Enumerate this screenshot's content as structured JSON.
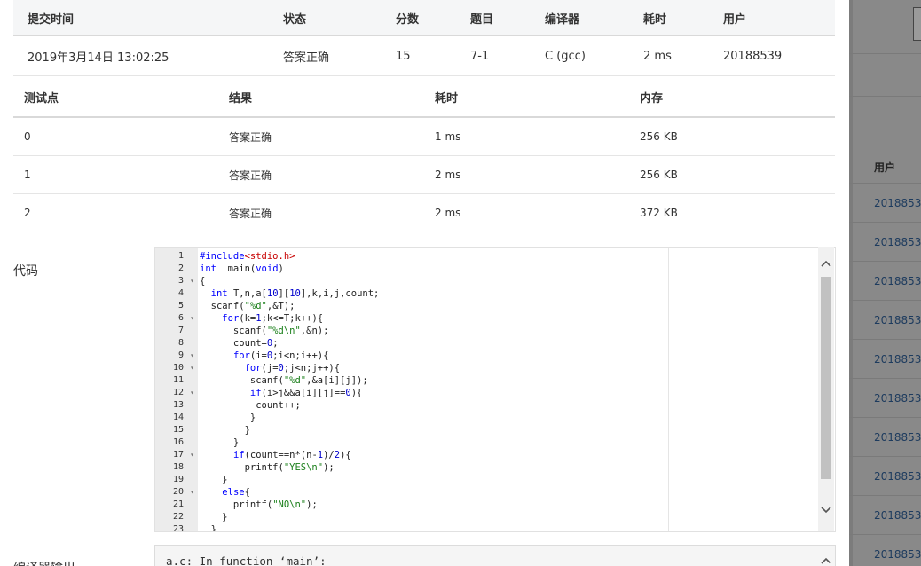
{
  "submission": {
    "headers": [
      "提交时间",
      "状态",
      "分数",
      "题目",
      "编译器",
      "耗时",
      "用户"
    ],
    "row": {
      "time": "2019年3月14日 13:02:25",
      "status": "答案正确",
      "score": "15",
      "problem": "7-1",
      "compiler": "C (gcc)",
      "duration": "2 ms",
      "user": "20188539"
    }
  },
  "testcases": {
    "headers": [
      "测试点",
      "结果",
      "耗时",
      "内存"
    ],
    "rows": [
      {
        "id": "0",
        "result": "答案正确",
        "time": "1 ms",
        "memory": "256 KB"
      },
      {
        "id": "1",
        "result": "答案正确",
        "time": "2 ms",
        "memory": "256 KB"
      },
      {
        "id": "2",
        "result": "答案正确",
        "time": "2 ms",
        "memory": "372 KB"
      }
    ]
  },
  "code_label": "代码",
  "compile_label": "编译器输出",
  "compile_output": "a.c: In function ‘main’:",
  "code": {
    "lines": [
      {
        "n": "1",
        "fold": "",
        "tokens": [
          [
            "inc",
            "#include"
          ],
          [
            "incpath",
            "<stdio.h>"
          ]
        ]
      },
      {
        "n": "2",
        "fold": "",
        "tokens": [
          [
            "kw",
            "int"
          ],
          [
            "",
            "  main("
          ],
          [
            "kw",
            "void"
          ],
          [
            "",
            ")"
          ]
        ]
      },
      {
        "n": "3",
        "fold": "▾",
        "tokens": [
          [
            "",
            "{"
          ]
        ]
      },
      {
        "n": "4",
        "fold": "",
        "tokens": [
          [
            "",
            "  "
          ],
          [
            "kw",
            "int"
          ],
          [
            "",
            " T,n,a["
          ],
          [
            "num",
            "10"
          ],
          [
            "",
            "]["
          ],
          [
            "num",
            "10"
          ],
          [
            "",
            "],k,i,j,count;"
          ]
        ]
      },
      {
        "n": "5",
        "fold": "",
        "tokens": [
          [
            "",
            "  scanf("
          ],
          [
            "str",
            "\"%d\""
          ],
          [
            "",
            ",&T);"
          ]
        ]
      },
      {
        "n": "6",
        "fold": "▾",
        "tokens": [
          [
            "",
            "    "
          ],
          [
            "kw",
            "for"
          ],
          [
            "",
            "(k="
          ],
          [
            "num",
            "1"
          ],
          [
            "",
            ";k<=T;k++){"
          ]
        ]
      },
      {
        "n": "7",
        "fold": "",
        "tokens": [
          [
            "",
            "      scanf("
          ],
          [
            "str",
            "\"%d\\n\""
          ],
          [
            "",
            ",&n);"
          ]
        ]
      },
      {
        "n": "8",
        "fold": "",
        "tokens": [
          [
            "",
            "      count="
          ],
          [
            "num",
            "0"
          ],
          [
            "",
            ";"
          ]
        ]
      },
      {
        "n": "9",
        "fold": "▾",
        "tokens": [
          [
            "",
            "      "
          ],
          [
            "kw",
            "for"
          ],
          [
            "",
            "(i="
          ],
          [
            "num",
            "0"
          ],
          [
            "",
            ";i<n;i++){"
          ]
        ]
      },
      {
        "n": "10",
        "fold": "▾",
        "tokens": [
          [
            "",
            "        "
          ],
          [
            "kw",
            "for"
          ],
          [
            "",
            "(j="
          ],
          [
            "num",
            "0"
          ],
          [
            "",
            ";j<n;j++){"
          ]
        ]
      },
      {
        "n": "11",
        "fold": "",
        "tokens": [
          [
            "",
            "         scanf("
          ],
          [
            "str",
            "\"%d\""
          ],
          [
            "",
            ",&a[i][j]);"
          ]
        ]
      },
      {
        "n": "12",
        "fold": "▾",
        "tokens": [
          [
            "",
            "         "
          ],
          [
            "kw",
            "if"
          ],
          [
            "",
            "(i>j&&a[i][j]=="
          ],
          [
            "num",
            "0"
          ],
          [
            "",
            "){"
          ]
        ]
      },
      {
        "n": "13",
        "fold": "",
        "tokens": [
          [
            "",
            "          count++;"
          ]
        ]
      },
      {
        "n": "14",
        "fold": "",
        "tokens": [
          [
            "",
            "         }"
          ]
        ]
      },
      {
        "n": "15",
        "fold": "",
        "tokens": [
          [
            "",
            "        }"
          ]
        ]
      },
      {
        "n": "16",
        "fold": "",
        "tokens": [
          [
            "",
            "      }"
          ]
        ]
      },
      {
        "n": "17",
        "fold": "▾",
        "tokens": [
          [
            "",
            "      "
          ],
          [
            "kw",
            "if"
          ],
          [
            "",
            "(count==n*(n-"
          ],
          [
            "num",
            "1"
          ],
          [
            "",
            ")/"
          ],
          [
            "num",
            "2"
          ],
          [
            "",
            "){"
          ]
        ]
      },
      {
        "n": "18",
        "fold": "",
        "tokens": [
          [
            "",
            "        printf("
          ],
          [
            "str",
            "\"YES\\n\""
          ],
          [
            "",
            ");"
          ]
        ]
      },
      {
        "n": "19",
        "fold": "",
        "tokens": [
          [
            "",
            "    }"
          ]
        ]
      },
      {
        "n": "20",
        "fold": "▾",
        "tokens": [
          [
            "",
            "    "
          ],
          [
            "kw",
            "else"
          ],
          [
            "",
            "{"
          ]
        ]
      },
      {
        "n": "21",
        "fold": "",
        "tokens": [
          [
            "",
            "      printf("
          ],
          [
            "str",
            "\"NO\\n\""
          ],
          [
            "",
            ");"
          ]
        ]
      },
      {
        "n": "22",
        "fold": "",
        "tokens": [
          [
            "",
            "    }"
          ]
        ]
      },
      {
        "n": "23",
        "fold": "",
        "tokens": [
          [
            "",
            "  }"
          ]
        ]
      }
    ]
  },
  "side_panel": {
    "header": "用户",
    "cells": [
      "2018853",
      "2018853",
      "2018853",
      "2018853",
      "2018853",
      "2018853",
      "2018853",
      "2018853",
      "2018853",
      "2018853"
    ]
  },
  "icons": {
    "scroll_up": "chevron-up-icon",
    "scroll_down": "chevron-down-icon",
    "fold": "fold-arrow-icon"
  },
  "colors": {
    "accepted": "#e03c3c",
    "link": "#2d6ca6"
  }
}
